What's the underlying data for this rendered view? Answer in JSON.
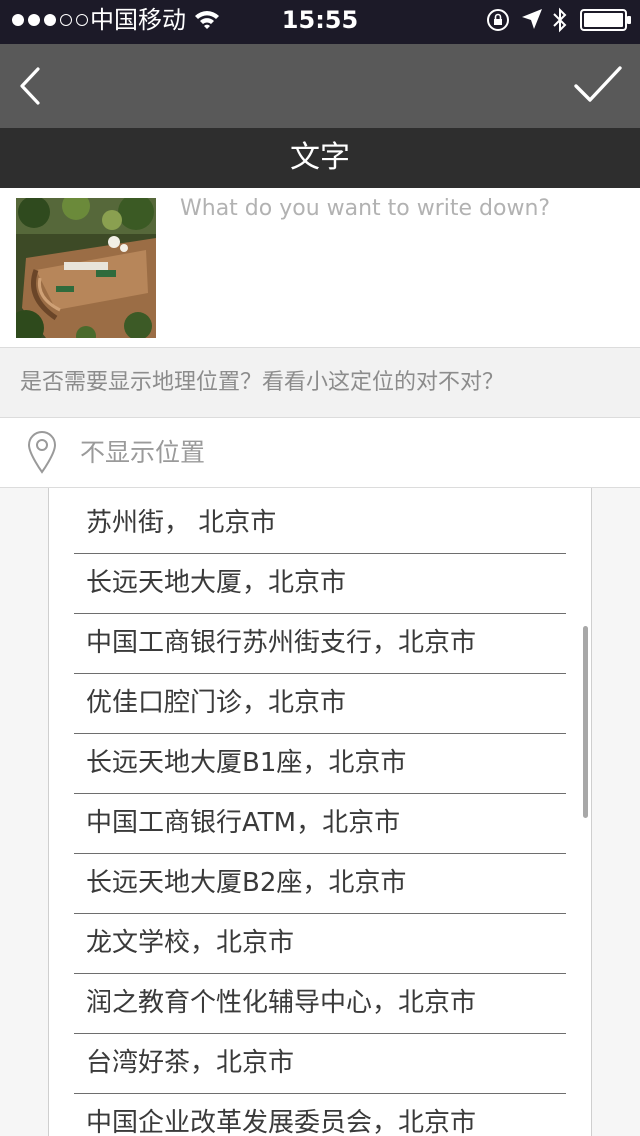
{
  "status_bar": {
    "carrier": "中国移动",
    "time": "15:55",
    "signal_bars_filled": 3,
    "signal_bars_total": 5
  },
  "nav": {
    "back_icon": "chevron-left-icon",
    "confirm_icon": "checkmark-icon"
  },
  "title": "文字",
  "compose": {
    "placeholder": "What do you want to write down?",
    "value": ""
  },
  "geo_question": "是否需要显示地理位置？看看小这定位的对不对？",
  "location": {
    "icon": "map-pin-icon",
    "label": "不显示位置"
  },
  "places": [
    "苏州街， 北京市",
    "长远天地大厦，北京市",
    "中国工商银行苏州街支行，北京市",
    "优佳口腔门诊，北京市",
    "长远天地大厦B1座，北京市",
    "中国工商银行ATM，北京市",
    "长远天地大厦B2座，北京市",
    "龙文学校，北京市",
    "润之教育个性化辅导中心，北京市",
    "台湾好茶，北京市",
    "中国企业改革发展委员会，北京市"
  ],
  "colors": {
    "status_bar_bg": "#1c1a28",
    "nav_bg": "#595959",
    "title_bg": "#2e2e2e",
    "page_bg": "#f6f6f6"
  }
}
